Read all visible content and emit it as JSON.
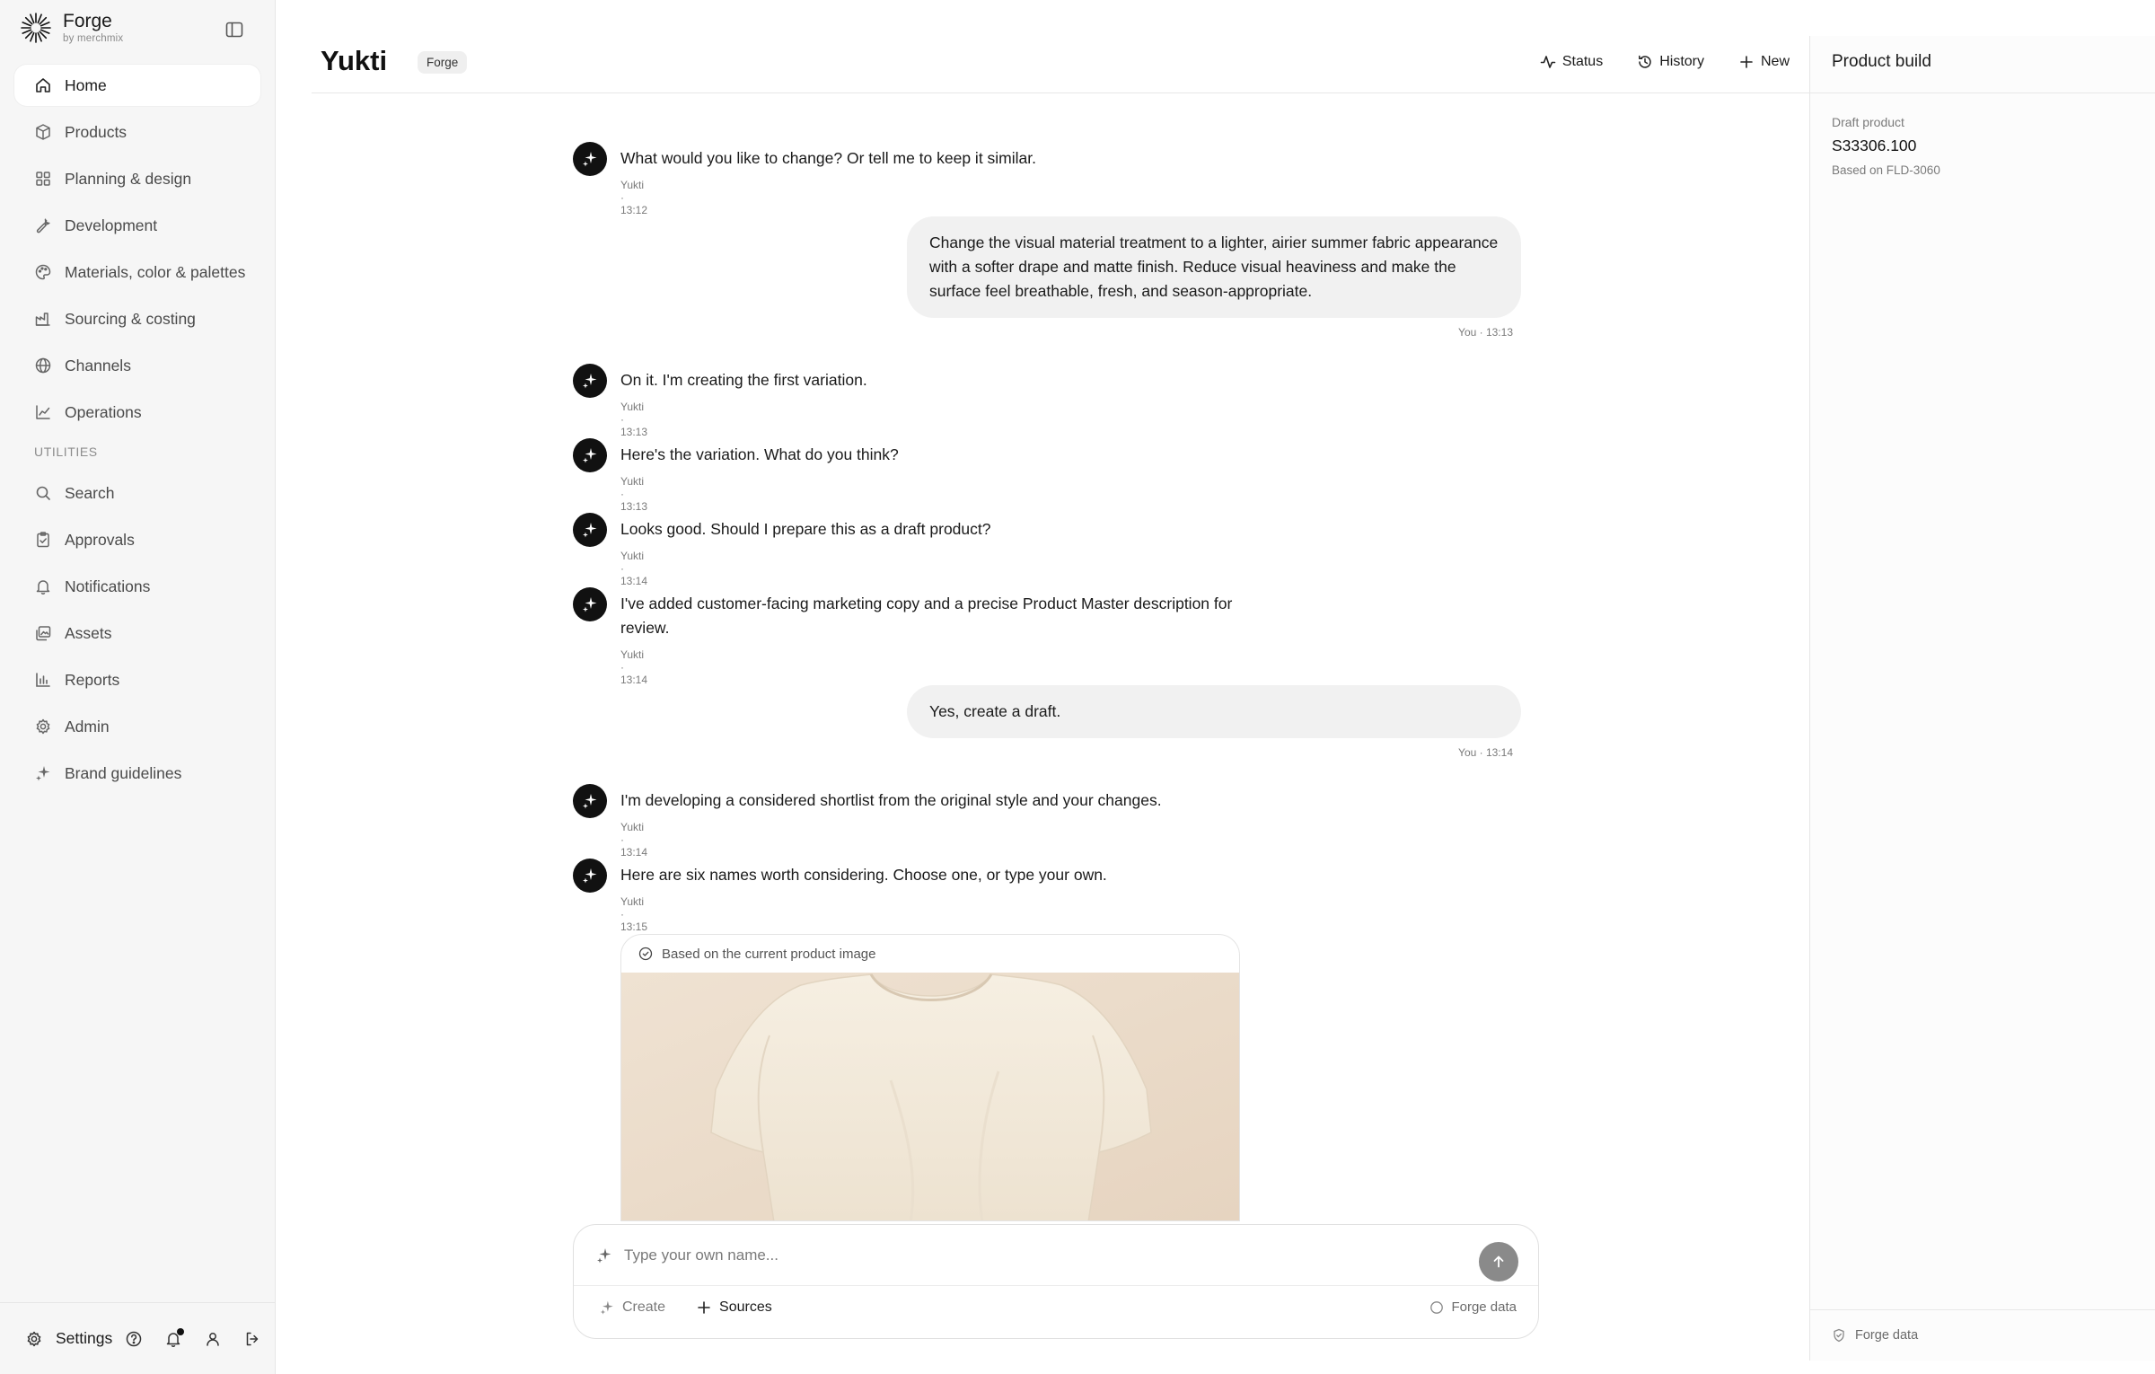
{
  "app": {
    "name": "Forge",
    "byline": "by merchmix"
  },
  "nav": {
    "items": [
      {
        "label": "Home",
        "icon": "home-icon",
        "active": true
      },
      {
        "label": "Products",
        "icon": "box-icon"
      },
      {
        "label": "Planning & design",
        "icon": "grid-icon"
      },
      {
        "label": "Development",
        "icon": "wrench-icon"
      },
      {
        "label": "Materials, color & palettes",
        "icon": "palette-icon"
      },
      {
        "label": "Sourcing & costing",
        "icon": "factory-icon"
      },
      {
        "label": "Channels",
        "icon": "globe-icon"
      },
      {
        "label": "Operations",
        "icon": "chart-line-icon"
      }
    ],
    "utilities_heading": "UTILITIES",
    "utilities": [
      {
        "label": "Search",
        "icon": "search-icon"
      },
      {
        "label": "Approvals",
        "icon": "clipboard-check-icon"
      },
      {
        "label": "Notifications",
        "icon": "bell-icon"
      },
      {
        "label": "Assets",
        "icon": "images-icon"
      },
      {
        "label": "Reports",
        "icon": "bar-chart-icon"
      },
      {
        "label": "Admin",
        "icon": "gear-icon"
      },
      {
        "label": "Brand guidelines",
        "icon": "sparkle-icon"
      }
    ]
  },
  "footer": {
    "settings_label": "Settings"
  },
  "header": {
    "title": "Yukti",
    "badge": "Forge",
    "actions": {
      "status": "Status",
      "history": "History",
      "new": "New"
    }
  },
  "messages": [
    {
      "role": "assistant",
      "text": "What would you like to change? Or tell me to keep it similar.",
      "meta": "Yukti · 13:12"
    },
    {
      "role": "user",
      "text": "Change the visual material treatment to a lighter, airier summer fabric appearance with a softer drape and matte finish. Reduce visual heaviness and make the surface feel breathable, fresh, and season-appropriate.",
      "meta": "You · 13:13"
    },
    {
      "role": "assistant",
      "text": "On it. I'm creating the first variation.",
      "meta": "Yukti · 13:13"
    },
    {
      "role": "assistant",
      "text": "Here's the variation. What do you think?",
      "meta": "Yukti · 13:13"
    },
    {
      "role": "assistant",
      "text": "Looks good. Should I prepare this as a draft product?",
      "meta": "Yukti · 13:14"
    },
    {
      "role": "assistant",
      "text": "I've added customer-facing marketing copy and a precise Product Master description for review.",
      "meta": "Yukti · 13:14"
    },
    {
      "role": "user",
      "text": "Yes, create a draft.",
      "meta": "You · 13:14"
    },
    {
      "role": "assistant",
      "text": "I'm developing a considered shortlist from the original style and your changes.",
      "meta": "Yukti · 13:14"
    },
    {
      "role": "assistant",
      "text": "Here are six names worth considering. Choose one, or type your own.",
      "meta": "Yukti · 13:15"
    }
  ],
  "image_card": {
    "caption": "Based on the current product image",
    "subject": "cream-t-shirt-image"
  },
  "composer": {
    "placeholder": "Type your own name...",
    "create_label": "Create",
    "sources_label": "Sources",
    "forge_data_label": "Forge data"
  },
  "panel": {
    "title": "Product build",
    "draft_label": "Draft product",
    "product_code": "S33306.100",
    "based_on": "Based on FLD-3060",
    "footer_label": "Forge data"
  },
  "colors": {
    "accent": "#111111",
    "sidebar_bg": "#f6f6f6",
    "bubble_bg": "#f1f1f1",
    "send_button": "#8a8a8a"
  }
}
